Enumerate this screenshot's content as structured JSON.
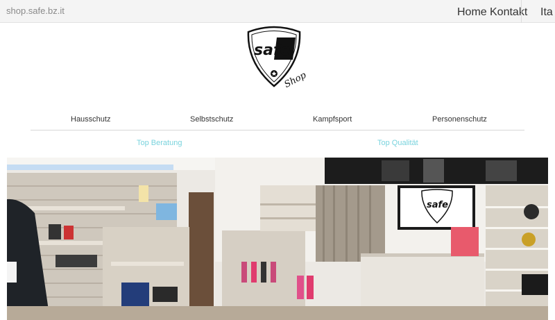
{
  "topbar": {
    "site_name": "shop.safe.bz.it",
    "nav": {
      "home": "Home",
      "kontakt": "Kontakt",
      "language": "Ita"
    }
  },
  "logo": {
    "brand_text": "safe",
    "script_text": "Shop"
  },
  "category_nav": {
    "items": [
      "Hausschutz",
      "Selbstschutz",
      "Kampfsport",
      "Personenschutz"
    ]
  },
  "taglines": {
    "left": "Top Beratung",
    "right": "Top Qualität"
  },
  "hero": {
    "monitor_text": "safe"
  },
  "colors": {
    "accent": "#79d3dd",
    "topbar_bg": "#f4f4f4"
  }
}
